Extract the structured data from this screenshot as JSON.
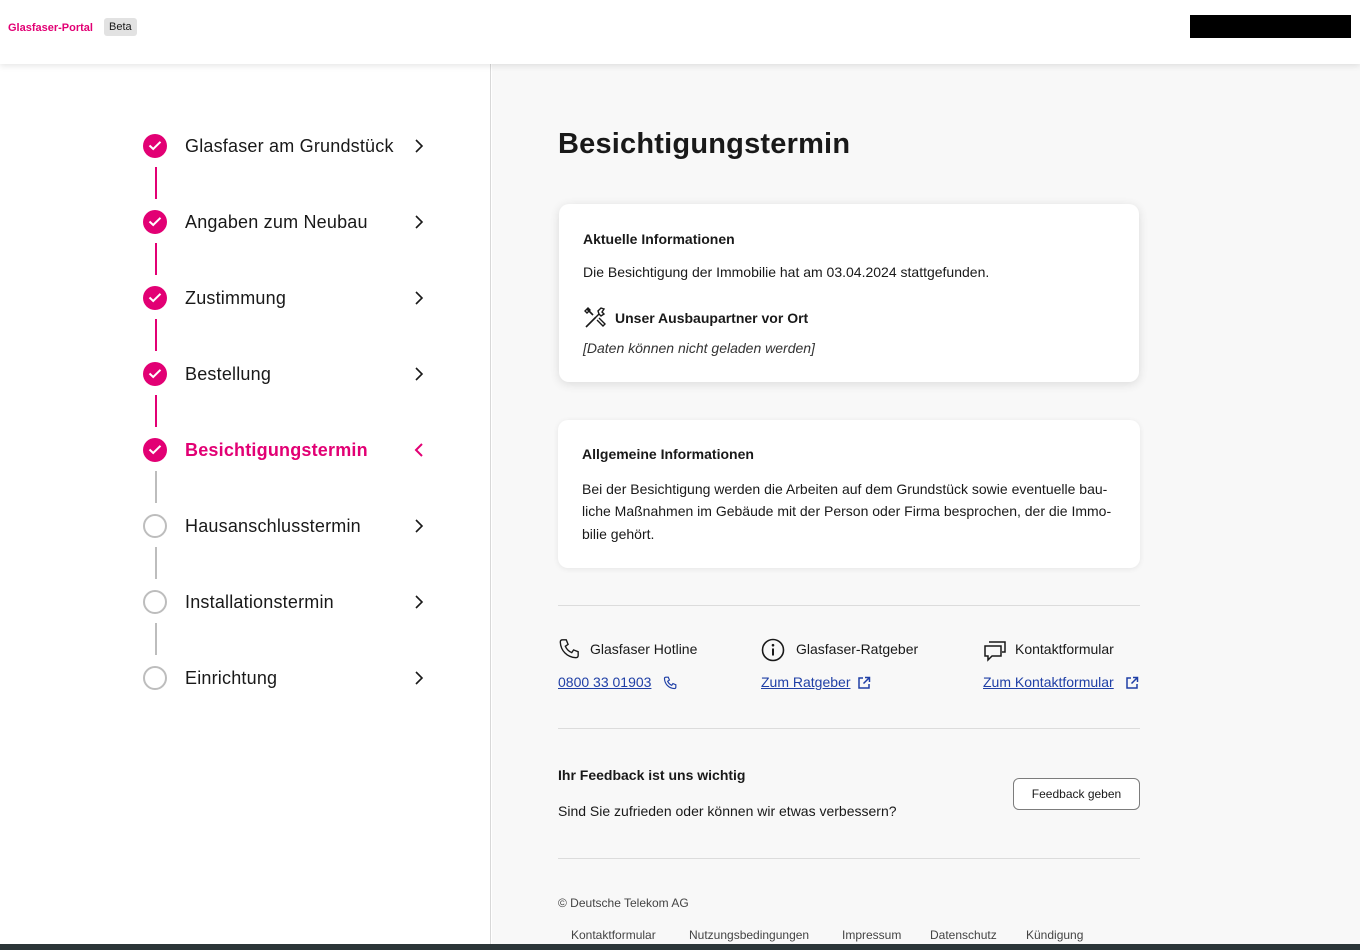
{
  "header": {
    "brand": "Glasfaser-Portal",
    "badge": "Beta"
  },
  "colors": {
    "accent": "#e20074",
    "link": "#1f3fa6",
    "inactive_step": "#bdbdbd"
  },
  "sidebar": {
    "steps": [
      {
        "label": "Glasfaser am Grundstück",
        "status": "done"
      },
      {
        "label": "Angaben zum Neubau",
        "status": "done"
      },
      {
        "label": "Zustimmung",
        "status": "done"
      },
      {
        "label": "Bestellung",
        "status": "done"
      },
      {
        "label": "Besichtigungstermin",
        "status": "active"
      },
      {
        "label": "Hausanschlusstermin",
        "status": "open"
      },
      {
        "label": "Installationstermin",
        "status": "open"
      },
      {
        "label": "Einrichtung",
        "status": "open"
      }
    ]
  },
  "main": {
    "title": "Besichtigungstermin",
    "current_info": {
      "title": "Aktuelle Informationen",
      "text": "Die Besichtigung der Immobilie hat am 03.04.2024 stattgefunden.",
      "partner_title": "Unser Ausbaupartner vor Ort",
      "partner_icon": "tools-icon",
      "partner_unavailable": "[Daten können nicht geladen werden]"
    },
    "general_info": {
      "title": "Allgemeine Informationen",
      "lines": [
        "Bei der Besichtigung werden die Arbeiten auf dem Grundstück sowie eventuelle bau-",
        "liche Maßnahmen im Gebäude mit der Person oder Firma besprochen, der die Immo-",
        "bilie gehört."
      ]
    },
    "contacts": [
      {
        "title": "Glasfaser Hotline",
        "link": "0800 33 01903",
        "icon": "phone-icon",
        "link_icon": "phone-icon"
      },
      {
        "title": "Glasfaser-Ratgeber",
        "link": "Zum Ratgeber",
        "icon": "info-icon",
        "link_icon": "external-link-icon"
      },
      {
        "title": "Kontaktformular",
        "link": "Zum Kontaktformular",
        "icon": "chat-icon",
        "link_icon": "external-link-icon"
      }
    ],
    "feedback": {
      "title": "Ihr Feedback ist uns wichtig",
      "text": "Sind Sie zufrieden oder können wir etwas verbessern?",
      "button": "Feedback geben"
    },
    "footer": {
      "copyright": "© Deutsche Telekom AG",
      "links": [
        "Kontaktformular",
        "Nutzungsbedingungen",
        "Impressum",
        "Datenschutz",
        "Kündigung"
      ]
    }
  }
}
